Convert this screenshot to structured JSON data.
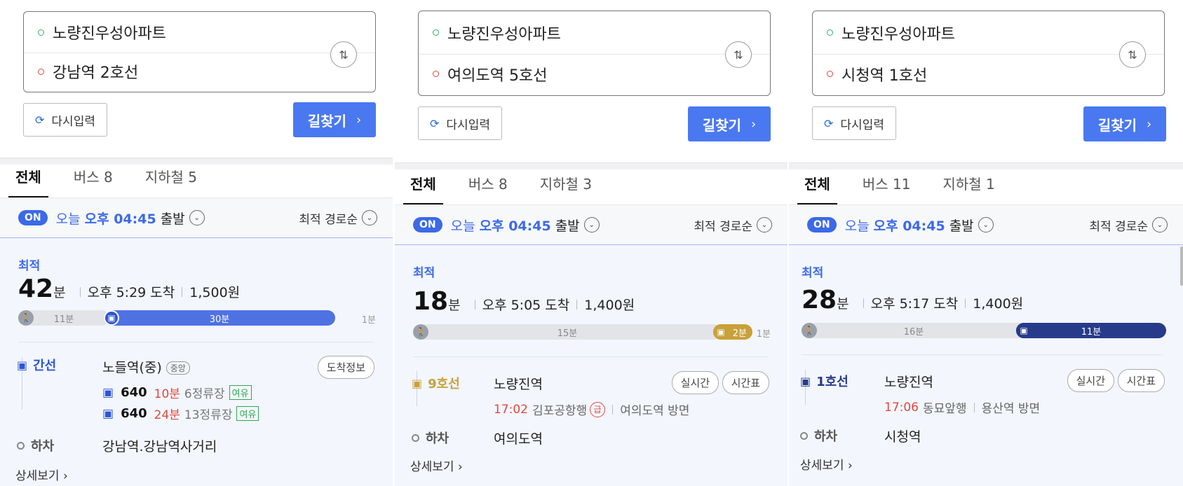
{
  "common": {
    "reset_label": "다시입력",
    "find_label": "길찾기",
    "tab_all": "전체",
    "on_badge": "ON",
    "depart_today": "오늘",
    "depart_time": "오후 04:45",
    "depart_word": "출발",
    "sort_label": "최적 경로순",
    "best_label": "최적",
    "alight_label": "하차",
    "detail_label": "상세보기",
    "min_unit": "분"
  },
  "panels": [
    {
      "origin": "노량진우성아파트",
      "destination": "강남역 2호선",
      "tab_bus": "버스 8",
      "tab_subway": "지하철 5",
      "minutes": "42",
      "arrival": "오후 5:29 도착",
      "fare": "1,500원",
      "bar": {
        "walk1": "11분",
        "main": "30분",
        "walk2": "1분"
      },
      "line_label": "간선",
      "line_color": "#2d55d1",
      "board_station": "노들역(중)",
      "board_tag": "중앙",
      "arrival_info_button": "도착정보",
      "buses": [
        {
          "number": "640",
          "wait": "10분",
          "stops": "6정류장",
          "crowd": "여유"
        },
        {
          "number": "640",
          "wait": "24분",
          "stops": "13정류장",
          "crowd": "여유"
        }
      ],
      "alight_station": "강남역.강남역사거리"
    },
    {
      "origin": "노량진우성아파트",
      "destination": "여의도역 5호선",
      "tab_bus": "버스 8",
      "tab_subway": "지하철 3",
      "minutes": "18",
      "arrival": "오후 5:05 도착",
      "fare": "1,400원",
      "bar": {
        "walk1": "15분",
        "main": "2분",
        "walk2": "1분"
      },
      "line_label": "9호선",
      "line_color": "#c9a03a",
      "board_station": "노량진역",
      "realtime_button": "실시간",
      "timetable_button": "시간표",
      "train_time": "17:02",
      "train_dest": "김포공항행",
      "express_mark": "급",
      "train_direction": "여의도역 방면",
      "alight_station": "여의도역"
    },
    {
      "origin": "노량진우성아파트",
      "destination": "시청역 1호선",
      "tab_bus": "버스 11",
      "tab_subway": "지하철 1",
      "minutes": "28",
      "arrival": "오후 5:17 도착",
      "fare": "1,400원",
      "bar": {
        "walk1": "16분",
        "main": "11분"
      },
      "line_label": "1호선",
      "line_color": "#263b8a",
      "board_station": "노량진역",
      "realtime_button": "실시간",
      "timetable_button": "시간표",
      "train_time": "17:06",
      "train_dest": "동묘앞행",
      "train_direction": "용산역 방면",
      "alight_station": "시청역"
    }
  ]
}
